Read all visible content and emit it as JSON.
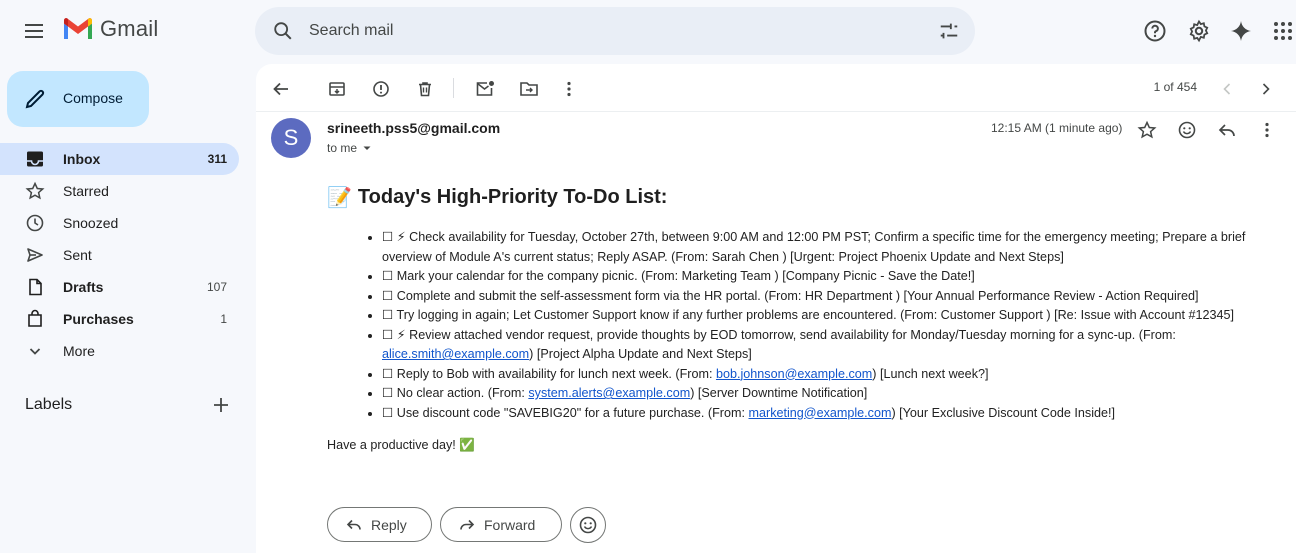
{
  "app": {
    "name": "Gmail"
  },
  "search": {
    "placeholder": "Search mail"
  },
  "compose": {
    "label": "Compose"
  },
  "sidebar": {
    "items": [
      {
        "label": "Inbox",
        "count": "311",
        "icon": "inbox-icon",
        "active": true
      },
      {
        "label": "Starred",
        "count": "",
        "icon": "star-icon"
      },
      {
        "label": "Snoozed",
        "count": "",
        "icon": "clock-icon"
      },
      {
        "label": "Sent",
        "count": "",
        "icon": "send-icon"
      },
      {
        "label": "Drafts",
        "count": "107",
        "icon": "draft-icon"
      },
      {
        "label": "Purchases",
        "count": "1",
        "icon": "shopping-bag-icon"
      },
      {
        "label": "More",
        "count": "",
        "icon": "chevron-down-icon"
      }
    ],
    "labels_title": "Labels"
  },
  "toolbar": {
    "pager": "1 of 454"
  },
  "message": {
    "avatar_letter": "S",
    "sender": "srineeth.pss5@gmail.com",
    "to": "to me",
    "timestamp": "12:15 AM (1 minute ago)",
    "title_emoji": "📝",
    "title": "Today's High-Priority To-Do List:",
    "items": [
      {
        "text": "☐ ⚡ Check availability for Tuesday, October 27th, between 9:00 AM and 12:00 PM PST; Confirm a specific time for the emergency meeting; Prepare a brief overview of Module A's current status; Reply ASAP. (From: Sarah Chen ) [Urgent: Project Phoenix Update and Next Steps]"
      },
      {
        "text": "☐ Mark your calendar for the company picnic. (From: Marketing Team ) [Company Picnic - Save the Date!]"
      },
      {
        "text": "☐ Complete and submit the self-assessment form via the HR portal. (From: HR Department ) [Your Annual Performance Review - Action Required]"
      },
      {
        "text": "☐ Try logging in again; Let Customer Support know if any further problems are encountered. (From: Customer Support ) [Re: Issue with Account #12345]"
      },
      {
        "pre": "☐ ⚡ Review attached vendor request, provide thoughts by EOD tomorrow, send availability for Monday/Tuesday morning for a sync-up. (From: ",
        "link": "alice.smith@example.com",
        "post": ") [Project Alpha Update and Next Steps]"
      },
      {
        "pre": "☐ Reply to Bob with availability for lunch next week. (From: ",
        "link": "bob.johnson@example.com",
        "post": ") [Lunch next week?]"
      },
      {
        "pre": "☐ No clear action. (From: ",
        "link": "system.alerts@example.com",
        "post": ") [Server Downtime Notification]"
      },
      {
        "pre": "☐ Use discount code \"SAVEBIG20\" for a future purchase. (From: ",
        "link": "marketing@example.com",
        "post": ") [Your Exclusive Discount Code Inside!]"
      }
    ],
    "signoff": "Have a productive day! ✅"
  },
  "actions": {
    "reply": "Reply",
    "forward": "Forward"
  },
  "colors": {
    "compose_bg": "#c2e7ff",
    "active_nav": "#d3e3fd",
    "avatar": "#5c6bc0",
    "link": "#1155cc"
  }
}
